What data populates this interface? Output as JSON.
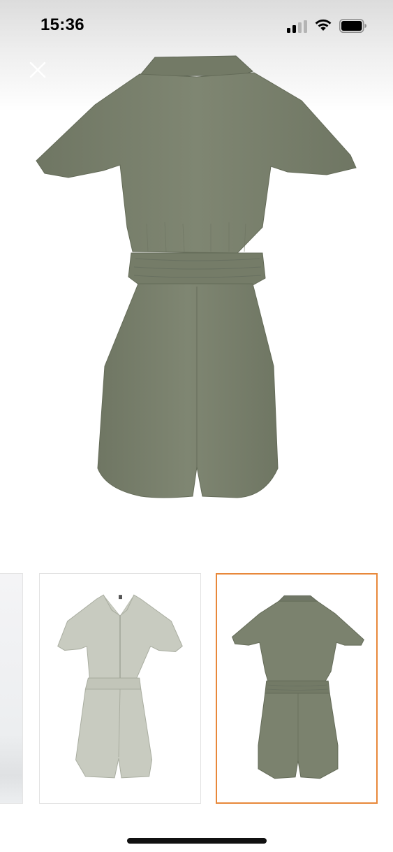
{
  "status_bar": {
    "time": "15:36",
    "icons": [
      "cellular-signal-icon",
      "wifi-icon",
      "battery-icon"
    ]
  },
  "viewer": {
    "close_icon": "close-icon",
    "main_image_alt": "product-back-view",
    "garment_color": "#7b826e"
  },
  "thumbnails": {
    "items": [
      "partial-previous-image",
      "front-view",
      "back-view"
    ],
    "selected_index": 2,
    "selected_border_color": "#e8883a"
  }
}
